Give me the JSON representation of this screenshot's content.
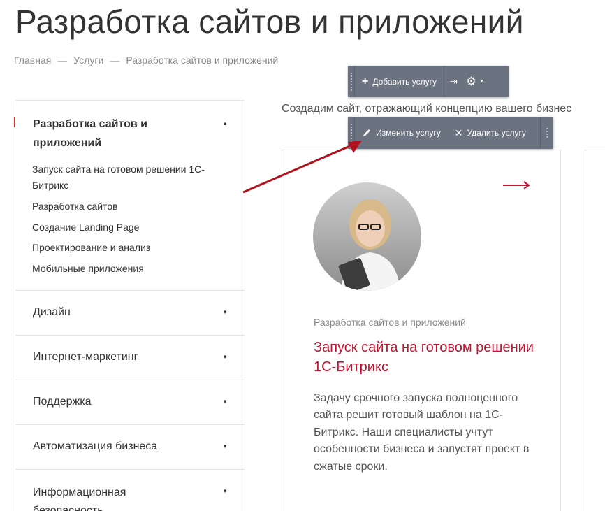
{
  "page": {
    "title": "Разработка сайтов и приложений"
  },
  "breadcrumb": {
    "items": [
      "Главная",
      "Услуги",
      "Разработка сайтов и приложений"
    ],
    "separator": "—"
  },
  "admin_toolbar_top": {
    "add_label": "Добавить услугу",
    "icons": [
      "plus-icon",
      "pin-icon",
      "gear-icon",
      "caret-down-icon"
    ]
  },
  "admin_toolbar_item": {
    "edit_label": "Изменить услугу",
    "delete_label": "Удалить услугу",
    "icons": [
      "pencil-icon",
      "close-icon"
    ]
  },
  "intro_text": "Создадим сайт, отражающий концепцию вашего бизнес",
  "sidebar": {
    "active_section": "Разработка сайтов и приложений",
    "sub_items": [
      "Запуск сайта на готовом решении 1С-Битрикс",
      "Разработка сайтов",
      "Создание Landing Page",
      "Проектирование и анализ",
      "Мобильные приложения"
    ],
    "sections": [
      "Дизайн",
      "Интернет-маркетинг",
      "Поддержка",
      "Автоматизация бизнеса",
      "Информационная безопасность"
    ]
  },
  "card": {
    "category": "Разработка сайтов и приложений",
    "title": "Запуск сайта на готовом решении 1С-Битрикс",
    "text": "Задачу срочного запуска полноценного сайта решит готовый шаблон на 1С-Битрикс. Наши специалисты учтут особенности бизнеса и запустят проект в сжатые сроки."
  },
  "colors": {
    "accent": "#c4122f",
    "toolbar": "#6c7380",
    "annotation_arrow": "#b3121f"
  }
}
